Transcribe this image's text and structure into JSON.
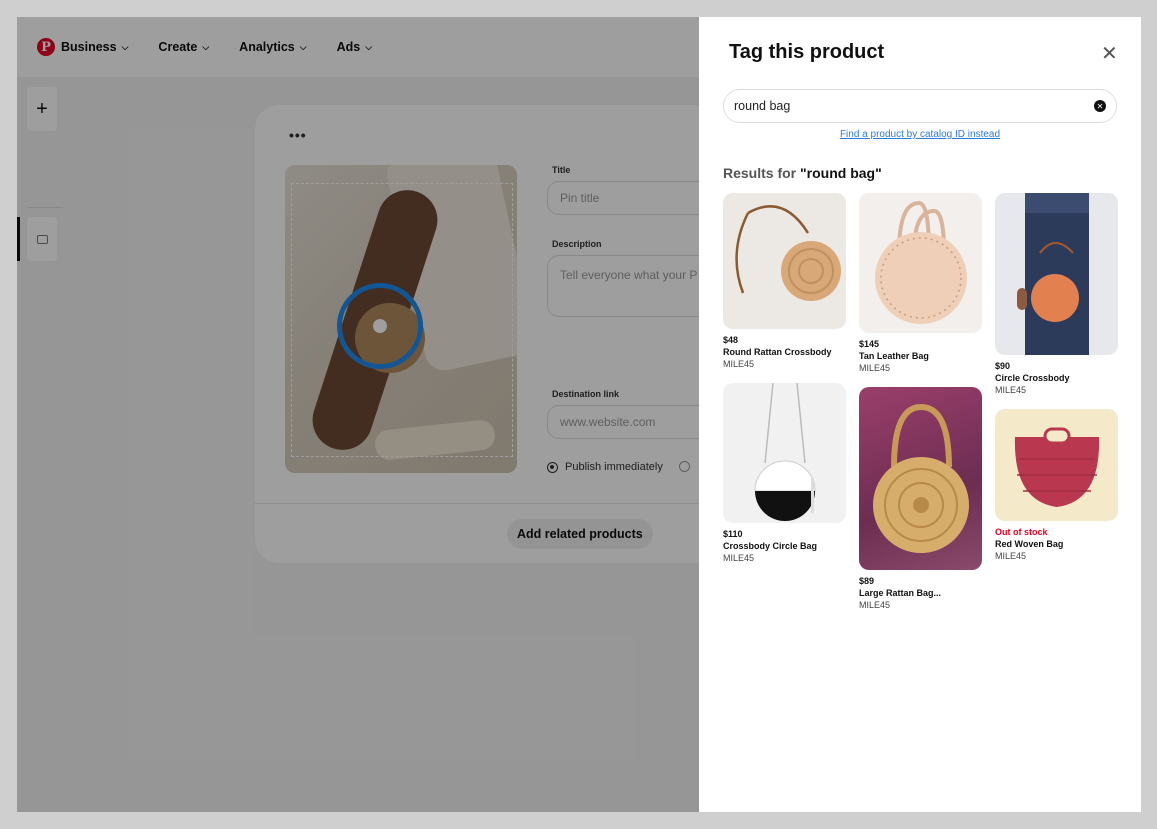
{
  "nav": {
    "brand": "P",
    "items": [
      {
        "label": "Business"
      },
      {
        "label": "Create"
      },
      {
        "label": "Analytics"
      },
      {
        "label": "Ads"
      }
    ],
    "chevron": "v"
  },
  "rail": {
    "add": "+"
  },
  "card": {
    "more": "•••",
    "title_label": "Title",
    "title_placeholder": "Pin title",
    "description_label": "Description",
    "description_placeholder": "Tell everyone what your P",
    "link_label": "Destination link",
    "link_placeholder": "www.website.com",
    "publish_now": "Publish immediately",
    "related_button": "Add related products"
  },
  "panel": {
    "title": "Tag this product",
    "close": "✕",
    "search_value": "round bag",
    "catalog_link": "Find a product by catalog ID instead",
    "results_prefix": "Results for ",
    "results_query": "\"round bag\"",
    "products": [
      {
        "price": "$48",
        "name": "Round Rattan Crossbody",
        "seller": "MILE45"
      },
      {
        "price": "$145",
        "name": "Tan Leather Bag",
        "seller": "MILE45"
      },
      {
        "price": "$90",
        "name": "Circle Crossbody",
        "seller": "MILE45"
      },
      {
        "price": "$110",
        "name": "Crossbody Circle Bag",
        "seller": "MILE45"
      },
      {
        "price": "$89",
        "name": "Large Rattan Bag...",
        "seller": "MILE45"
      },
      {
        "price": "Out of stock",
        "name": "Red Woven Bag",
        "seller": "MILE45"
      }
    ]
  },
  "colors": {
    "brand": "#e60023",
    "tag_ring": "#1e8cf0",
    "link": "#2b7bd9"
  }
}
